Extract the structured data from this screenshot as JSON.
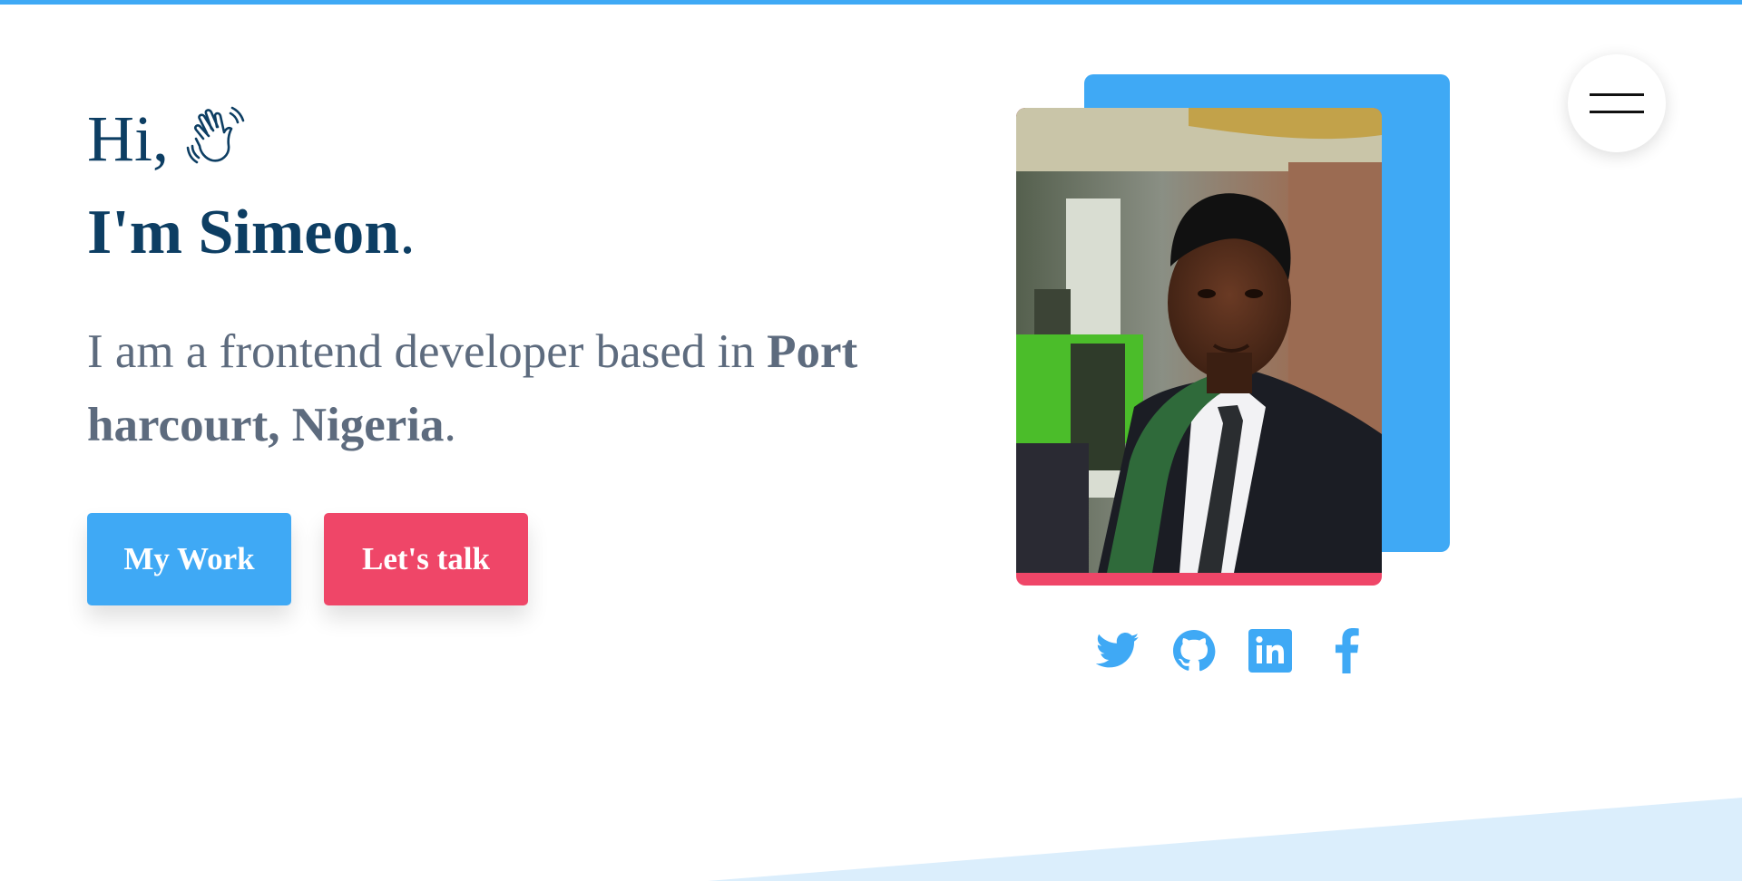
{
  "hero": {
    "greeting": "Hi,",
    "name_prefix": "I'm Simeon",
    "name_suffix": ".",
    "intro_text": "I am a frontend developer based in ",
    "intro_location": "Port harcourt, Nigeria",
    "intro_suffix": "."
  },
  "buttons": {
    "my_work": "My Work",
    "lets_talk": "Let's talk"
  },
  "socials": [
    "twitter-icon",
    "github-icon",
    "linkedin-icon",
    "facebook-icon"
  ],
  "menu": {
    "icon": "hamburger-menu-icon"
  },
  "colors": {
    "accent_blue": "#3fa9f5",
    "accent_red": "#ef4668",
    "heading": "#0d3e63",
    "body_text": "#5d6b7e",
    "wave": "#dbeefc"
  }
}
